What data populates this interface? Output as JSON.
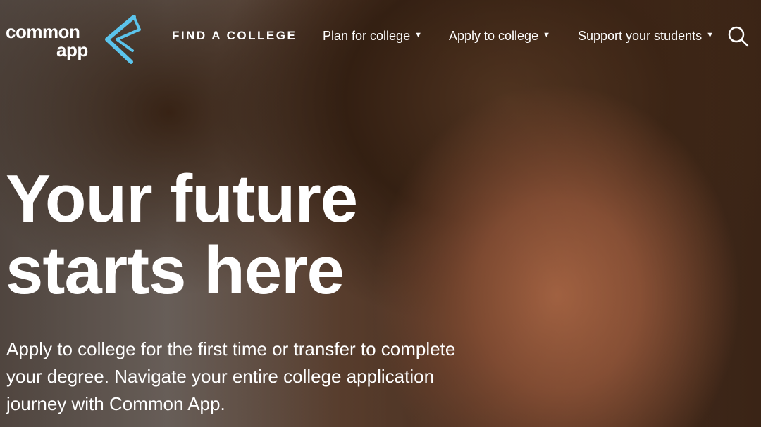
{
  "brand": {
    "line1": "common",
    "line2": "app",
    "accent_color": "#5bc4ec"
  },
  "nav": {
    "find": "FIND A COLLEGE",
    "plan": "Plan for college",
    "apply": "Apply to college",
    "support": "Support your students",
    "caret_icon": "caret-down-icon",
    "search_icon": "search-icon"
  },
  "hero": {
    "headline_line1": "Your future",
    "headline_line2": "starts here",
    "subtitle": "Apply to college for the first time or transfer to complete your degree. Navigate your entire college application journey with Common App."
  }
}
